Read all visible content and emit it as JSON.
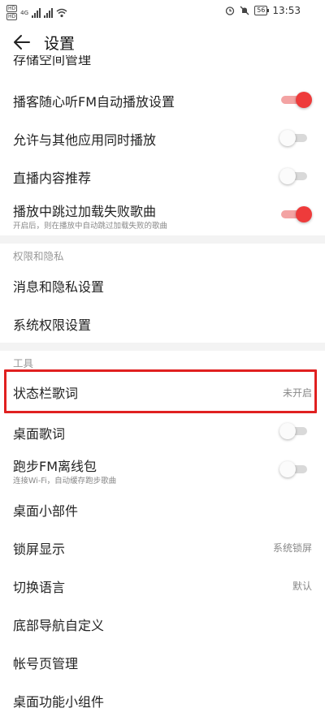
{
  "status": {
    "sim1": "HD",
    "sim2": "HD",
    "network": "4G",
    "battery": "56",
    "time": "13:53"
  },
  "header": {
    "title": "设置"
  },
  "partial_top_label": "存储空间管理",
  "sections": {
    "privacy_title": "权限和隐私",
    "tools_title": "工具"
  },
  "items": {
    "podcast_fm": "播客随心听FM自动播放设置",
    "allow_other_apps": "允许与其他应用同时播放",
    "live_recommend": "直播内容推荐",
    "skip_failed": "播放中跳过加载失败歌曲",
    "skip_failed_sub": "开启后，则在播放中自动跳过加载失败的歌曲",
    "message_privacy": "消息和隐私设置",
    "system_permission": "系统权限设置",
    "statusbar_lyrics": "状态栏歌词",
    "statusbar_lyrics_value": "未开启",
    "desktop_lyrics": "桌面歌词",
    "running_fm": "跑步FM离线包",
    "running_fm_sub": "连接Wi-Fi，自动缓存跑步歌曲",
    "desktop_widget": "桌面小部件",
    "lockscreen": "锁屏显示",
    "lockscreen_value": "系统锁屏",
    "language": "切换语言",
    "language_value": "默认",
    "bottom_nav": "底部导航自定义",
    "account_page": "帐号页管理",
    "desktop_func_widget": "桌面功能小组件"
  },
  "toggles": {
    "podcast_fm": true,
    "allow_other_apps": false,
    "live_recommend": false,
    "skip_failed": true,
    "desktop_lyrics": false,
    "running_fm": false
  },
  "colors": {
    "accent": "#ee3b3b",
    "highlight_box": "#e02020"
  }
}
